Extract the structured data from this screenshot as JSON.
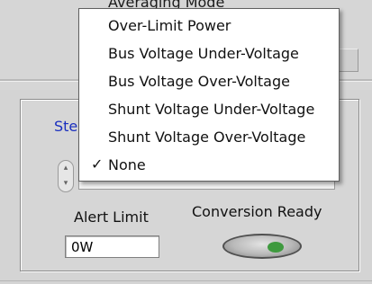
{
  "top": {
    "clipped_label": "Averaging Mode"
  },
  "group": {
    "label": "Ste"
  },
  "menu": {
    "items": [
      {
        "label": "Over-Limit Power",
        "checked": false
      },
      {
        "label": "Bus Voltage Under-Voltage",
        "checked": false
      },
      {
        "label": "Bus Voltage Over-Voltage",
        "checked": false
      },
      {
        "label": "Shunt Voltage Under-Voltage",
        "checked": false
      },
      {
        "label": "Shunt Voltage Over-Voltage",
        "checked": false
      },
      {
        "label": "None",
        "checked": true
      }
    ],
    "check_glyph": "✓"
  },
  "alert": {
    "label": "Alert Limit",
    "value": "0W"
  },
  "conversion": {
    "label": "Conversion Ready"
  },
  "colors": {
    "led_on": "#3f9a3f",
    "group_label": "#1a2fbf"
  }
}
